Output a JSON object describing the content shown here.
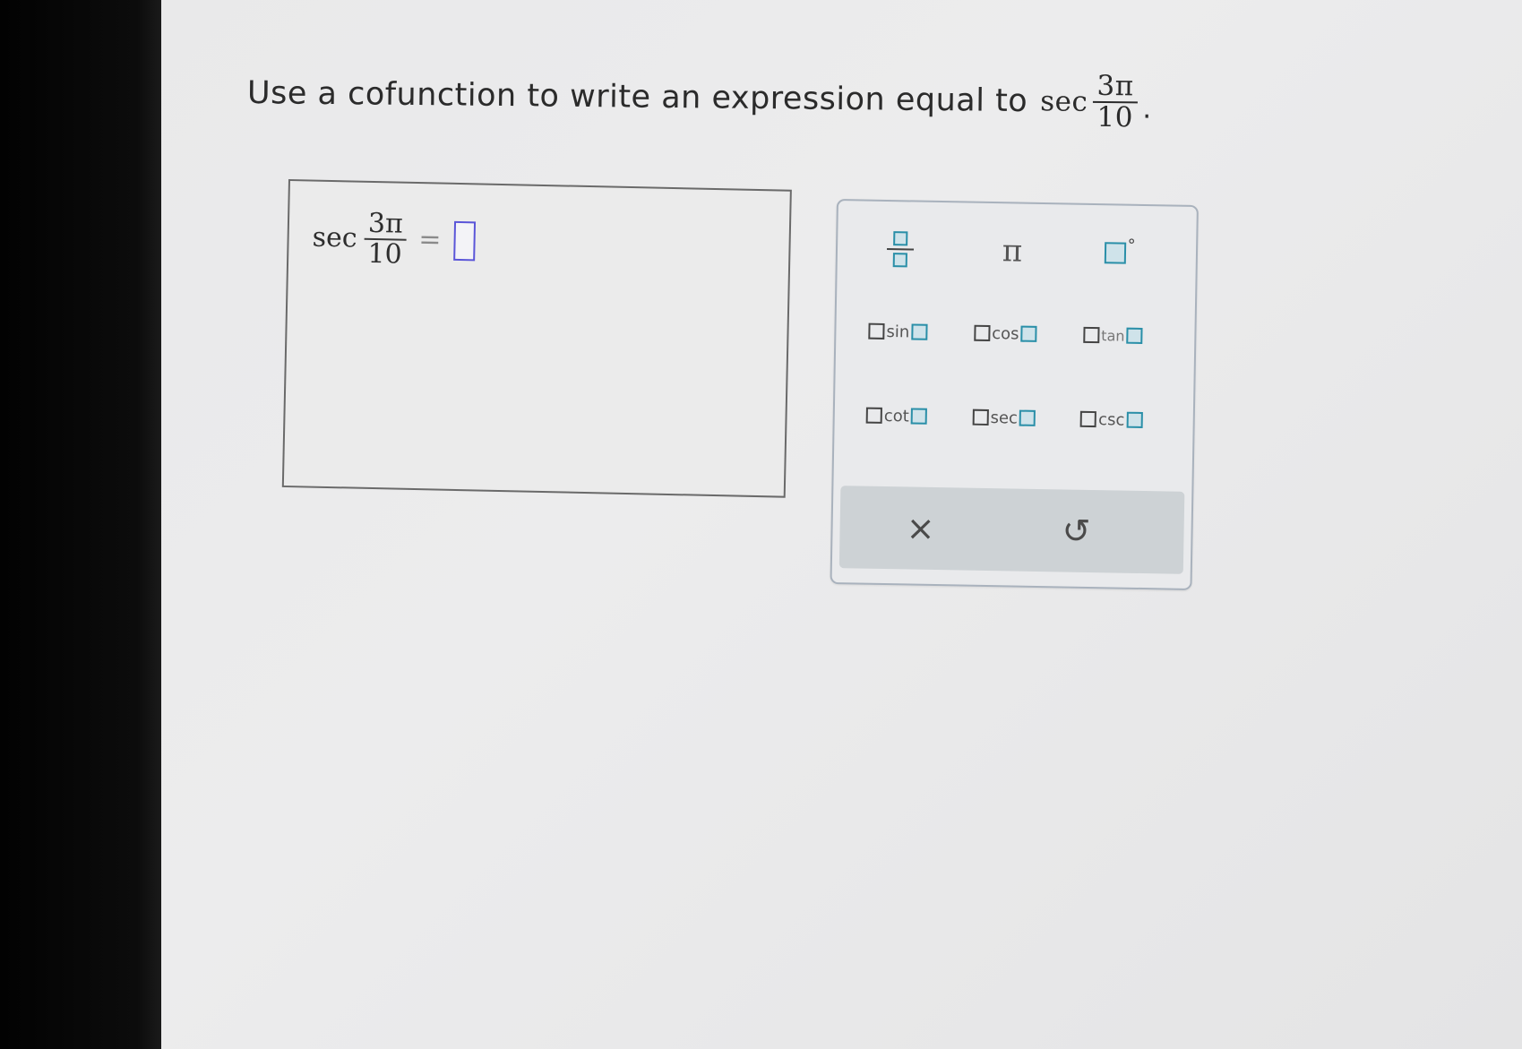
{
  "question": {
    "text": "Use a cofunction to write an expression equal to",
    "func": "sec",
    "numerator": "3π",
    "denominator": "10",
    "period": "."
  },
  "answer": {
    "func": "sec",
    "numerator": "3π",
    "denominator": "10",
    "equals": "="
  },
  "keypad": {
    "pi": "π",
    "degree": "°",
    "trig": [
      "sin",
      "cos",
      "tan",
      "cot",
      "sec",
      "csc"
    ],
    "clear_icon": "×",
    "undo_icon": "↺"
  },
  "colors": {
    "input_border": "#5a55d8",
    "teal_square": "#2a8fa8",
    "action_bar": "#cdd2d5"
  }
}
